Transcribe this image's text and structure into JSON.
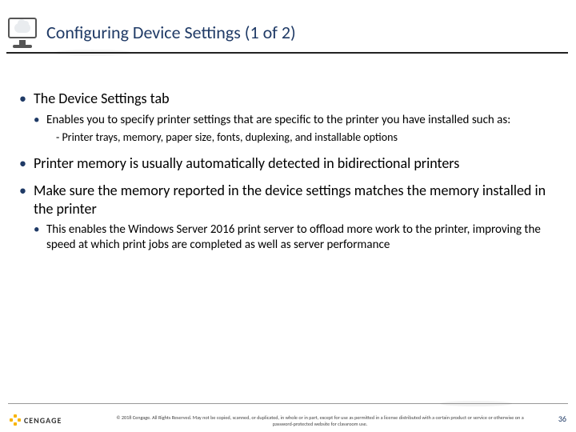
{
  "title": "Configuring Device Settings (1 of 2)",
  "bullets": {
    "b1": "The Device Settings tab",
    "b1_1": "Enables you to specify printer settings that are specific to the printer you have installed such as:",
    "b1_1_dash": "Printer trays, memory, paper size, fonts, duplexing, and installable options",
    "b2": "Printer memory is usually automatically detected in bidirectional printers",
    "b3": "Make sure the memory reported in the device settings matches the memory installed in the printer",
    "b3_1": "This enables the Windows Server 2016 print server to offload more work to the printer, improving the speed at which print jobs are completed as well as server performance"
  },
  "footer": {
    "logo": "CENGAGE",
    "copyright": "© 2018 Cengage. All Rights Reserved. May not be copied, scanned, or duplicated, in whole or in part, except for use as permitted in a license distributed with a certain product or service or otherwise on a password-protected website for classroom use.",
    "page": "36"
  }
}
